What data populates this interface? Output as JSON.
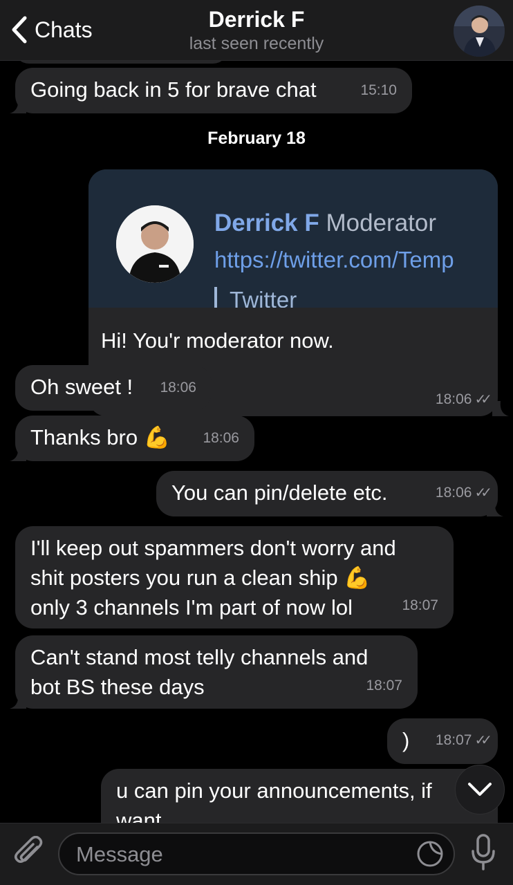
{
  "header": {
    "back_label": "Chats",
    "title": "Derrick F",
    "subtitle": "last seen recently"
  },
  "messages": {
    "m0": {
      "text": "Going back in 5 for brave chat",
      "time": "15:10"
    },
    "date": "February 18",
    "card": {
      "preview_name": "Derrick F",
      "preview_role": "Moderator",
      "preview_link": "https://twitter.com/Temp",
      "preview_source": "Twitter",
      "text": "Hi! You'r moderator now.",
      "time": "18:06"
    },
    "m2": {
      "text": "Oh sweet !",
      "time": "18:06"
    },
    "m3": {
      "text": "Thanks bro",
      "emoji": "💪",
      "time": "18:06"
    },
    "m4": {
      "text": "You can pin/delete etc.",
      "time": "18:06"
    },
    "m5": {
      "line1": "I'll keep out spammers don't worry and",
      "line2": "shit posters you run a clean ship",
      "emoji": "💪",
      "line3": "only 3 channels I'm part of now lol",
      "time": "18:07"
    },
    "m6": {
      "line1": "Can't stand most telly channels and",
      "line2": "bot BS these days",
      "time": "18:07"
    },
    "m7": {
      "text": ")",
      "time": "18:07"
    },
    "m8": {
      "line1": "u can pin your announcements, if",
      "line2": "want"
    }
  },
  "input": {
    "placeholder": "Message"
  },
  "icons": {
    "back": "chevron-left-icon",
    "read_receipt": "double-check-icon",
    "scroll_down": "chevron-down-icon",
    "attach": "paperclip-icon",
    "sticker": "sticker-icon",
    "mic": "microphone-icon"
  },
  "colors": {
    "background": "#000000",
    "bubble": "#262628",
    "link": "#6e9fe8",
    "secondary_text": "#8e8e93"
  }
}
